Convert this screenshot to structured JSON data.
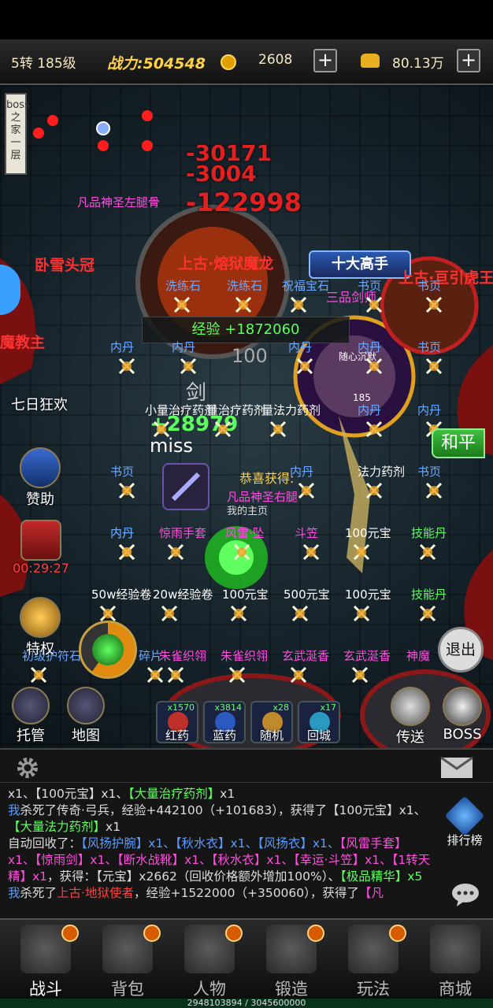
{
  "top": {
    "level": "5转 185级",
    "power_label": "战力:504548",
    "coins": "2608",
    "ingots": "80.13万"
  },
  "scene": {
    "boss_home": "boss之家一层",
    "damage": [
      "-30171",
      "-3004",
      "-122998"
    ],
    "exp_gain": "经验 +1872060",
    "heal": "+28979",
    "miss": "miss",
    "congrats": "恭喜获得:",
    "congrats_item": "凡品神圣右腿",
    "my_home": "我的主页",
    "ranking_title": "十大高手",
    "guild_title": "三品剑师",
    "npc_text": "随心沉默",
    "peace": "和平",
    "exit": "退出",
    "number_100": "100",
    "number_185": "185",
    "sword_glyph": "剑",
    "labels_left": {
      "event": "七日狂欢",
      "sponsor": "赞助",
      "timer": "00:29:27",
      "privilege": "特权",
      "auto": "托管",
      "map": "地图"
    },
    "drops": [
      {
        "t": "凡品神圣左腿骨",
        "c": "pink"
      },
      {
        "t": "卧雪头冠",
        "c": "red"
      },
      {
        "t": "上古·熔狱魔龙",
        "c": "red"
      },
      {
        "t": "上古·亘引虎王",
        "c": "red"
      },
      {
        "t": "洗练石",
        "c": "blue"
      },
      {
        "t": "洗练石",
        "c": "blue"
      },
      {
        "t": "祝福宝石",
        "c": "blue"
      },
      {
        "t": "书页",
        "c": "blue"
      },
      {
        "t": "书页",
        "c": "blue"
      },
      {
        "t": "内丹",
        "c": "blue"
      },
      {
        "t": "内丹",
        "c": "blue"
      },
      {
        "t": "内丹",
        "c": "blue"
      },
      {
        "t": "内丹",
        "c": "blue"
      },
      {
        "t": "书页",
        "c": "blue"
      },
      {
        "t": "小量治疗药剂",
        "c": "white"
      },
      {
        "t": "量治疗药剂",
        "c": "white"
      },
      {
        "t": "量法力药剂",
        "c": "white"
      },
      {
        "t": "内丹",
        "c": "blue"
      },
      {
        "t": "内丹",
        "c": "blue"
      },
      {
        "t": "书页",
        "c": "blue"
      },
      {
        "t": "内丹",
        "c": "blue"
      },
      {
        "t": "法力药剂",
        "c": "white"
      },
      {
        "t": "内丹",
        "c": "blue"
      },
      {
        "t": "书页",
        "c": "blue"
      },
      {
        "t": "内丹",
        "c": "blue"
      },
      {
        "t": "惊雨手套",
        "c": "pink"
      },
      {
        "t": "风雷·坠",
        "c": "pink"
      },
      {
        "t": "斗笠",
        "c": "pink"
      },
      {
        "t": "100元宝",
        "c": "white"
      },
      {
        "t": "技能丹",
        "c": "green"
      },
      {
        "t": "50w经验卷",
        "c": "white"
      },
      {
        "t": "20w经验卷",
        "c": "white"
      },
      {
        "t": "100元宝",
        "c": "white"
      },
      {
        "t": "500元宝",
        "c": "white"
      },
      {
        "t": "100元宝",
        "c": "white"
      },
      {
        "t": "技能丹",
        "c": "green"
      },
      {
        "t": "初级护符石",
        "c": "blue"
      },
      {
        "t": "碎片",
        "c": "blue"
      },
      {
        "t": "朱雀织翎",
        "c": "pink"
      },
      {
        "t": "朱雀织翎",
        "c": "pink"
      },
      {
        "t": "玄武涎香",
        "c": "pink"
      },
      {
        "t": "玄武涎香",
        "c": "pink"
      },
      {
        "t": "神魔",
        "c": "pink"
      },
      {
        "t": "魔教主",
        "c": "red"
      }
    ]
  },
  "quickbar": [
    {
      "count": "x1570",
      "name": "红药",
      "color": "#c0302a"
    },
    {
      "count": "x3814",
      "name": "蓝药",
      "color": "#2a5ac0"
    },
    {
      "count": "x28",
      "name": "随机",
      "color": "#c08a2a"
    },
    {
      "count": "x17",
      "name": "回城",
      "color": "#2a9ac0"
    }
  ],
  "right_buttons": {
    "send": "传送",
    "boss": "BOSS"
  },
  "chat": {
    "ranking": "排行榜",
    "lines_html_free": [
      [
        {
          "t": "x1、【100元宝】x1、",
          "c": "#ddd"
        },
        {
          "t": "【大量治疗药剂】",
          "c": "#5dff5d"
        },
        {
          "t": "x1",
          "c": "#ddd"
        }
      ],
      [
        {
          "t": "我",
          "c": "#5a9bff"
        },
        {
          "t": "杀死了传奇·弓兵，经验+442100（+101683），获得了【100元宝】x1、",
          "c": "#ddd"
        },
        {
          "t": "【大量法力药剂】",
          "c": "#5dff5d"
        },
        {
          "t": "x1",
          "c": "#ddd"
        }
      ],
      [
        {
          "t": "自动回收了：",
          "c": "#ddd"
        },
        {
          "t": "【风扬护腕】x1、【秋水衣】x1、【风扬衣】x1、",
          "c": "#5a9bff"
        },
        {
          "t": "【风雷手套】x1、【惊雨剑】x1、【断水战靴】x1、【秋水衣】x1、【幸运·斗笠】x1、【1转天精】x1",
          "c": "#ff4de0"
        },
        {
          "t": "，获得：【元宝】x2662（回收价格额外增加100%）、",
          "c": "#ddd"
        },
        {
          "t": "【极品精华】x5",
          "c": "#5dff5d"
        }
      ],
      [
        {
          "t": "我",
          "c": "#5a9bff"
        },
        {
          "t": "杀死了",
          "c": "#ddd"
        },
        {
          "t": "上古·地狱使者",
          "c": "#ff4040"
        },
        {
          "t": "，经验+1522000（+350060），获得了",
          "c": "#ddd"
        },
        {
          "t": "【凡",
          "c": "#ff4de0"
        }
      ]
    ]
  },
  "nav": [
    {
      "label": "战斗",
      "active": true
    },
    {
      "label": "背包",
      "active": false
    },
    {
      "label": "人物",
      "active": false
    },
    {
      "label": "锻造",
      "active": false
    },
    {
      "label": "玩法",
      "active": false
    },
    {
      "label": "商城",
      "active": false
    }
  ],
  "xp": "2948103894 / 3045600000"
}
